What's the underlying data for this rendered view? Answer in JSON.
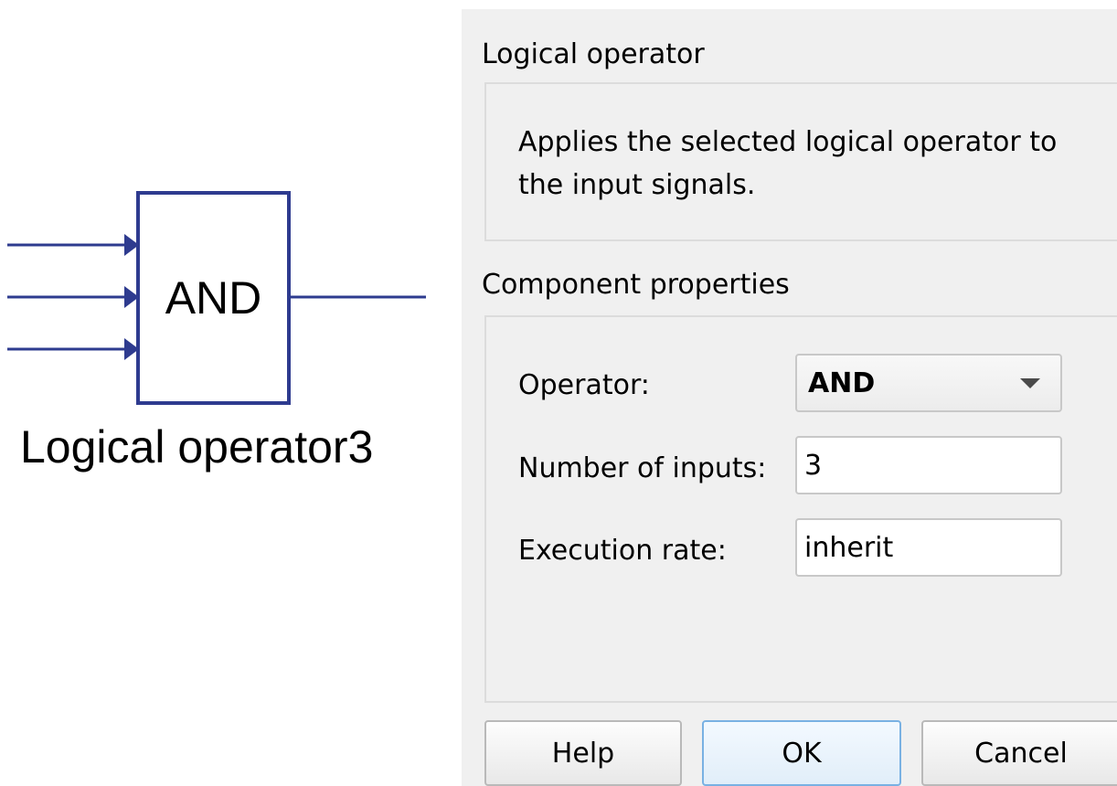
{
  "diagram": {
    "block_text": "AND",
    "block_name": "Logical operator3",
    "input_count": 3,
    "line_color": "#2e3b8f"
  },
  "dialog": {
    "title": "Logical operator",
    "description": "Applies the selected logical operator to the input signals.",
    "properties_title": "Component properties",
    "properties": {
      "operator_label": "Operator:",
      "operator_value": "AND",
      "inputs_label": "Number of inputs:",
      "inputs_value": "3",
      "rate_label": "Execution rate:",
      "rate_value": "inherit"
    },
    "buttons": {
      "help": "Help",
      "ok": "OK",
      "cancel": "Cancel"
    },
    "accent_color": "#79b1e3"
  }
}
